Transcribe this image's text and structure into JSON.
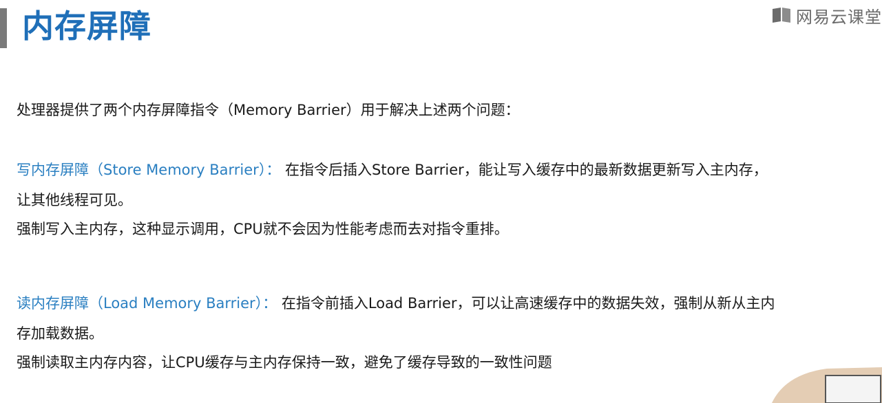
{
  "header": {
    "title": "内存屏障",
    "brand": "网易云课堂",
    "brand_icon": "netease-cloud-classroom-logo-icon",
    "accent_color": "#1f6fb8"
  },
  "intro": "处理器提供了两个内存屏障指令（Memory Barrier）用于解决上述两个问题：",
  "store_barrier": {
    "term": "写内存屏障（Store Memory Barrier）：",
    "desc_line1": "在指令后插入Store Barrier，能让写入缓存中的最新数据更新写入主内存，",
    "desc_line2": "让其他线程可见。",
    "note": "强制写入主内存，这种显示调用，CPU就不会因为性能考虑而去对指令重排。"
  },
  "load_barrier": {
    "term": "读内存屏障（Load Memory Barrier）：",
    "desc_line1": "在指令前插入Load Barrier，可以让高速缓存中的数据失效，强制从新从主内",
    "desc_line2": "存加载数据。",
    "note": "强制读取主内存内容，让CPU缓存与主内存保持一致，避免了缓存导致的一致性问题"
  }
}
